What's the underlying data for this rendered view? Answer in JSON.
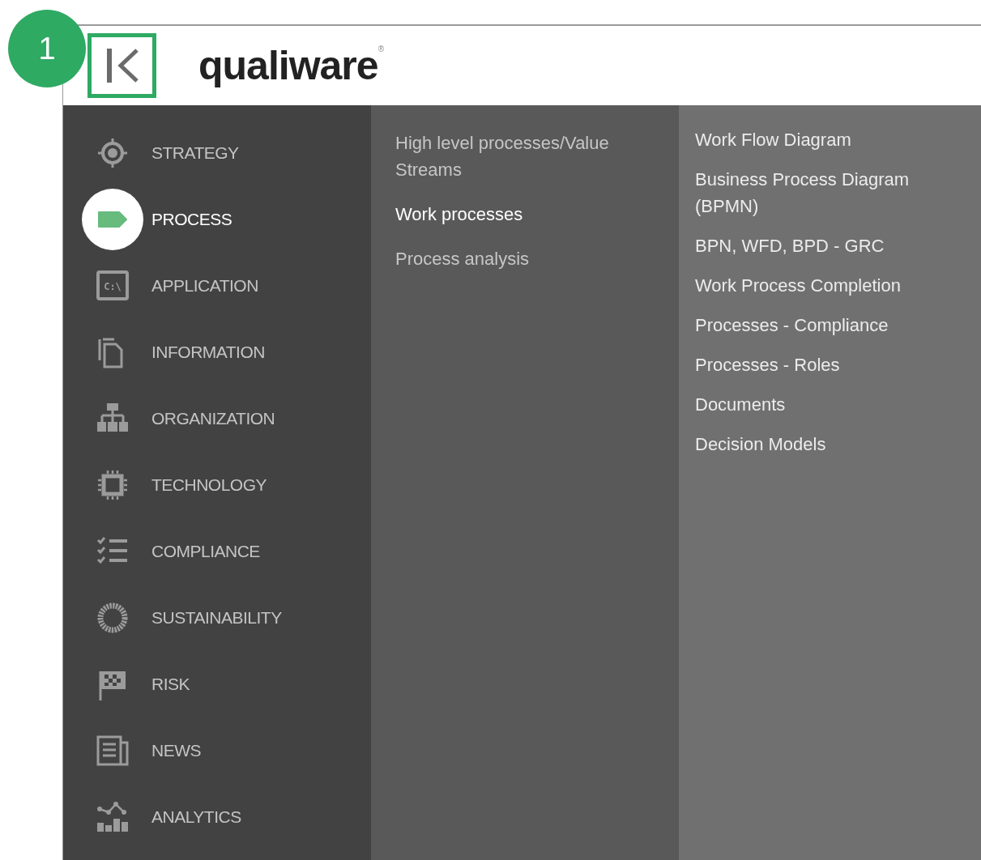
{
  "callout": {
    "number": "1"
  },
  "header": {
    "logo": "qualiware",
    "logo_mark": "®"
  },
  "sidebar": {
    "items": [
      {
        "label": "STRATEGY",
        "selected": false
      },
      {
        "label": "PROCESS",
        "selected": true
      },
      {
        "label": "APPLICATION",
        "selected": false,
        "icon_text": "C:\\"
      },
      {
        "label": "INFORMATION",
        "selected": false
      },
      {
        "label": "ORGANIZATION",
        "selected": false
      },
      {
        "label": "TECHNOLOGY",
        "selected": false
      },
      {
        "label": "COMPLIANCE",
        "selected": false
      },
      {
        "label": "SUSTAINABILITY",
        "selected": false
      },
      {
        "label": "RISK",
        "selected": false
      },
      {
        "label": "NEWS",
        "selected": false
      },
      {
        "label": "ANALYTICS",
        "selected": false
      }
    ]
  },
  "submenu": {
    "items": [
      {
        "label": "High level processes/Value Streams",
        "selected": false
      },
      {
        "label": "Work processes",
        "selected": true
      },
      {
        "label": "Process analysis",
        "selected": false
      }
    ]
  },
  "models": {
    "items": [
      {
        "label": "Work Flow Diagram"
      },
      {
        "label": "Business Process Diagram (BPMN)"
      },
      {
        "label": "BPN, WFD, BPD - GRC"
      },
      {
        "label": "Work Process Completion"
      },
      {
        "label": "Processes - Compliance"
      },
      {
        "label": "Processes - Roles"
      },
      {
        "label": "Documents"
      },
      {
        "label": "Decision Models"
      }
    ]
  }
}
